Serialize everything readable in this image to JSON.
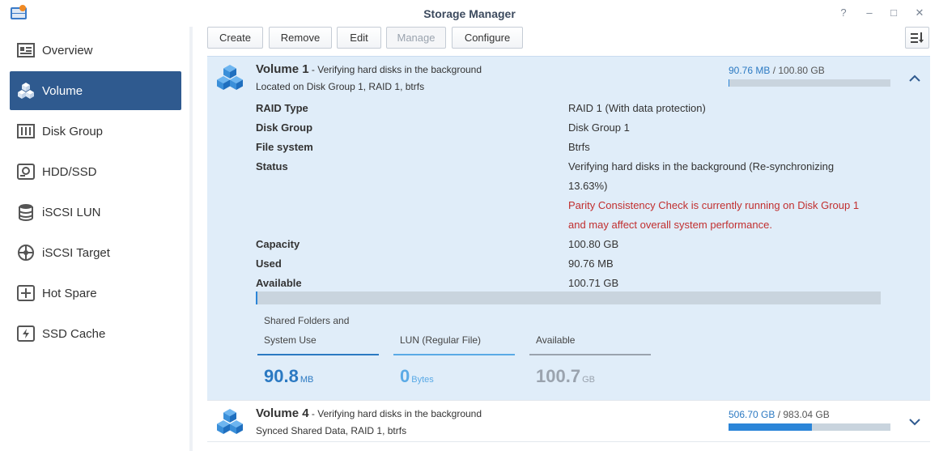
{
  "window": {
    "title": "Storage Manager",
    "controls": {
      "help": "?",
      "minimize": "–",
      "maximize": "□",
      "close": "✕"
    }
  },
  "sidebar": {
    "items": [
      {
        "label": "Overview",
        "icon": "overview-icon",
        "active": false
      },
      {
        "label": "Volume",
        "icon": "volume-icon",
        "active": true
      },
      {
        "label": "Disk Group",
        "icon": "disk-group-icon",
        "active": false
      },
      {
        "label": "HDD/SSD",
        "icon": "hdd-icon",
        "active": false
      },
      {
        "label": "iSCSI LUN",
        "icon": "iscsi-lun-icon",
        "active": false
      },
      {
        "label": "iSCSI Target",
        "icon": "iscsi-target-icon",
        "active": false
      },
      {
        "label": "Hot Spare",
        "icon": "hot-spare-icon",
        "active": false
      },
      {
        "label": "SSD Cache",
        "icon": "ssd-cache-icon",
        "active": false
      }
    ]
  },
  "toolbar": {
    "create": "Create",
    "remove": "Remove",
    "edit": "Edit",
    "manage": "Manage",
    "configure": "Configure",
    "manage_disabled": true
  },
  "volume1": {
    "name": "Volume 1",
    "status_desc": " - Verifying hard disks in the background",
    "location": "Located on Disk Group 1, RAID 1, btrfs",
    "used": "90.76 MB",
    "total": " / 100.80 GB",
    "usage_fraction": 0.0009,
    "expanded": true,
    "properties": {
      "raid_type_label": "RAID Type",
      "raid_type_value": "RAID 1 (With data protection)",
      "disk_group_label": "Disk Group",
      "disk_group_value": "Disk Group 1",
      "file_system_label": "File system",
      "file_system_value": "Btrfs",
      "status_label": "Status",
      "status_line1": "Verifying hard disks in the background (Re-synchronizing",
      "status_line2": "13.63%)",
      "warning_line1": "Parity Consistency Check is currently running on Disk Group 1",
      "warning_line2": "and may affect overall system performance.",
      "capacity_label": "Capacity",
      "capacity_value": "100.80 GB",
      "used_label": "Used",
      "used_value": "90.76 MB",
      "available_label": "Available",
      "available_value": "100.71 GB"
    },
    "legend": {
      "shared_label_1": "Shared Folders and",
      "shared_label_2": "System Use",
      "shared_value": "90.8",
      "shared_unit": "MB",
      "lun_label": "LUN (Regular File)",
      "lun_value": "0",
      "lun_unit": "Bytes",
      "available_label": "Available",
      "available_value": "100.7",
      "available_unit": "GB"
    },
    "colors": {
      "shared": "#2b79c2",
      "lun": "#5aaae6",
      "available": "#9aa3ae"
    }
  },
  "volume4": {
    "name": "Volume 4",
    "status_desc": " - Verifying hard disks in the background",
    "location": "Synced Shared Data, RAID 1, btrfs",
    "used": "506.70 GB",
    "total": " / 983.04 GB",
    "usage_fraction": 0.515,
    "expanded": false
  }
}
